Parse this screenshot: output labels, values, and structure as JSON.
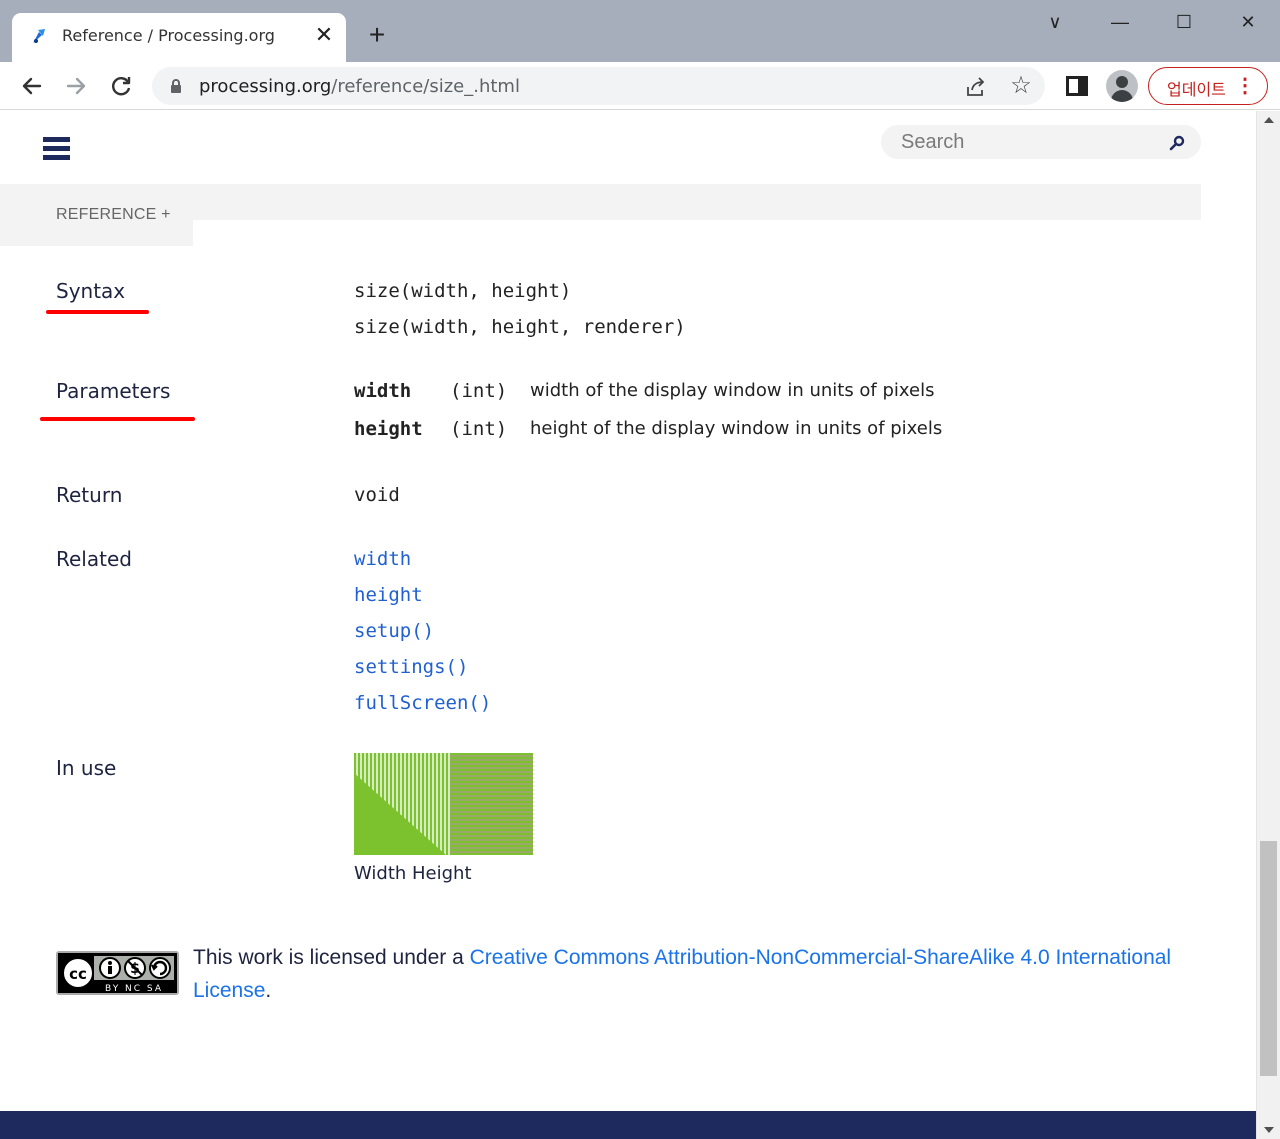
{
  "browser": {
    "tab_title": "Reference / Processing.org",
    "tab_close": "✕",
    "new_tab": "+",
    "url_host": "processing.org",
    "url_path": "/reference/size_.html",
    "update_label": "업데이트",
    "update_menu": "⋮",
    "window_controls": {
      "collapse": "∨",
      "minimize": "—",
      "maximize": "☐",
      "close": "✕"
    }
  },
  "site": {
    "search_placeholder": "Search",
    "breadcrumb_label": "REFERENCE +",
    "menu_icon": "hamburger-menu-icon"
  },
  "content": {
    "syntax": {
      "label": "Syntax",
      "lines": [
        "size(width, height)",
        "size(width, height, renderer)"
      ]
    },
    "parameters": {
      "label": "Parameters",
      "items": [
        {
          "name": "width",
          "type": "(int)",
          "description": "width of the display window in units of pixels"
        },
        {
          "name": "height",
          "type": "(int)",
          "description": "height of the display window in units of pixels"
        }
      ]
    },
    "return": {
      "label": "Return",
      "value": "void"
    },
    "related": {
      "label": "Related",
      "links": [
        "width",
        "height",
        "setup()",
        "settings()",
        "fullScreen()"
      ]
    },
    "in_use": {
      "label": "In use",
      "caption": "Width Height"
    },
    "license": {
      "prefix": "This work is licensed under a ",
      "link_text": "Creative Commons Attribution-NonCommercial-ShareAlike 4.0 International License",
      "suffix": ".",
      "badge_text": "BY NC SA"
    }
  },
  "colors": {
    "accent_navy": "#1e2a5e",
    "link_blue": "#1a73e8",
    "annotation_red": "#ff0000",
    "update_red": "#c5221f"
  }
}
